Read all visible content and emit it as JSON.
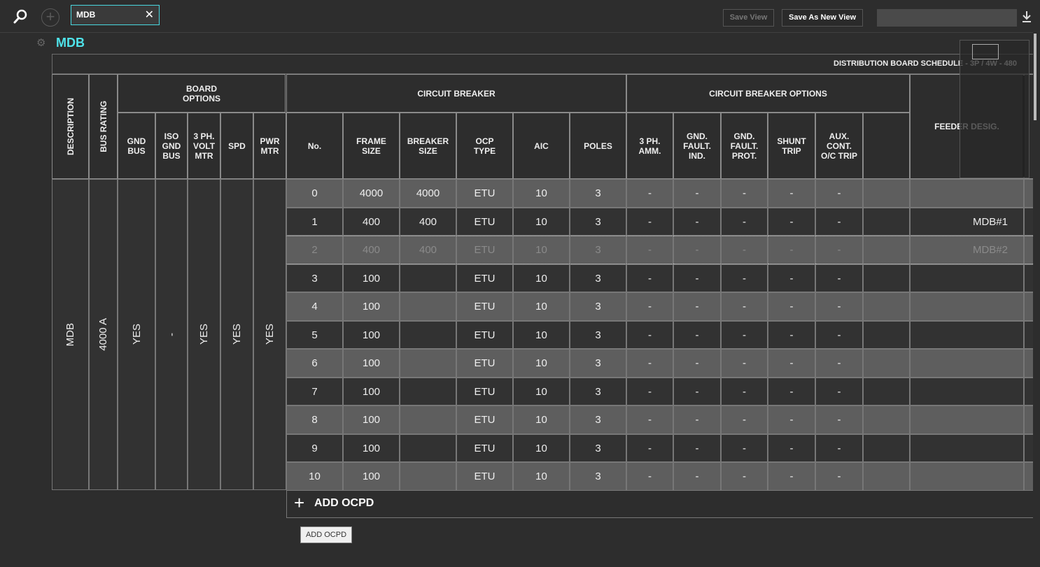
{
  "toolbar": {
    "tab_label": "MDB",
    "tab_close": "✕",
    "add_label": "+",
    "save_view": "Save View",
    "save_as_new_view": "Save As New View",
    "view_name_value": "",
    "download_glyph": "⤓"
  },
  "page": {
    "title": "MDB",
    "schedule_title": "DISTRIBUTION BOARD SCHEDULE - 3P / 4W - 480"
  },
  "headers": {
    "description": "DESCRIPTION",
    "bus_rating": "BUS RATING",
    "board_options": "BOARD OPTIONS",
    "gnd_bus": "GND BUS",
    "iso_gnd_bus": "ISO GND BUS",
    "volt_mtr": "3 PH. VOLT MTR",
    "spd": "SPD",
    "pwr_mtr": "PWR MTR",
    "circuit_breaker": "CIRCUIT BREAKER",
    "no": "No.",
    "frame_size": "FRAME SIZE",
    "breaker_size": "BREAKER SIZE",
    "ocp_type": "OCP TYPE",
    "aic": "AIC",
    "poles": "POLES",
    "cb_options": "CIRCUIT BREAKER OPTIONS",
    "ph_amm": "3 PH. AMM.",
    "gnd_fault_ind": "GND. FAULT. IND.",
    "gnd_fault_prot": "GND. FAULT. PROT.",
    "shunt_trip": "SHUNT TRIP",
    "aux_cont": "AUX. CONT. O/C TRIP",
    "feeder_desig": "FEEDER DESIG."
  },
  "board": {
    "description": "MDB",
    "bus_rating": "4000 A",
    "gnd_bus": "YES",
    "iso_gnd_bus": "-",
    "volt_mtr": "YES",
    "spd": "YES",
    "pwr_mtr": "YES"
  },
  "rows": [
    {
      "no": "0",
      "frame": "4000",
      "breaker": "4000",
      "ocp": "ETU",
      "aic": "10",
      "poles": "3",
      "amm": "-",
      "gfi": "-",
      "gfp": "-",
      "shunt": "-",
      "aux": "-",
      "feeder": ""
    },
    {
      "no": "1",
      "frame": "400",
      "breaker": "400",
      "ocp": "ETU",
      "aic": "10",
      "poles": "3",
      "amm": "-",
      "gfi": "-",
      "gfp": "-",
      "shunt": "-",
      "aux": "-",
      "feeder": "MDB#1"
    },
    {
      "no": "2",
      "frame": "400",
      "breaker": "400",
      "ocp": "ETU",
      "aic": "10",
      "poles": "3",
      "amm": "-",
      "gfi": "-",
      "gfp": "-",
      "shunt": "-",
      "aux": "-",
      "feeder": "MDB#2"
    },
    {
      "no": "3",
      "frame": "100",
      "breaker": "",
      "ocp": "ETU",
      "aic": "10",
      "poles": "3",
      "amm": "-",
      "gfi": "-",
      "gfp": "-",
      "shunt": "-",
      "aux": "-",
      "feeder": ""
    },
    {
      "no": "4",
      "frame": "100",
      "breaker": "",
      "ocp": "ETU",
      "aic": "10",
      "poles": "3",
      "amm": "-",
      "gfi": "-",
      "gfp": "-",
      "shunt": "-",
      "aux": "-",
      "feeder": ""
    },
    {
      "no": "5",
      "frame": "100",
      "breaker": "",
      "ocp": "ETU",
      "aic": "10",
      "poles": "3",
      "amm": "-",
      "gfi": "-",
      "gfp": "-",
      "shunt": "-",
      "aux": "-",
      "feeder": ""
    },
    {
      "no": "6",
      "frame": "100",
      "breaker": "",
      "ocp": "ETU",
      "aic": "10",
      "poles": "3",
      "amm": "-",
      "gfi": "-",
      "gfp": "-",
      "shunt": "-",
      "aux": "-",
      "feeder": ""
    },
    {
      "no": "7",
      "frame": "100",
      "breaker": "",
      "ocp": "ETU",
      "aic": "10",
      "poles": "3",
      "amm": "-",
      "gfi": "-",
      "gfp": "-",
      "shunt": "-",
      "aux": "-",
      "feeder": ""
    },
    {
      "no": "8",
      "frame": "100",
      "breaker": "",
      "ocp": "ETU",
      "aic": "10",
      "poles": "3",
      "amm": "-",
      "gfi": "-",
      "gfp": "-",
      "shunt": "-",
      "aux": "-",
      "feeder": ""
    },
    {
      "no": "9",
      "frame": "100",
      "breaker": "",
      "ocp": "ETU",
      "aic": "10",
      "poles": "3",
      "amm": "-",
      "gfi": "-",
      "gfp": "-",
      "shunt": "-",
      "aux": "-",
      "feeder": ""
    },
    {
      "no": "10",
      "frame": "100",
      "breaker": "",
      "ocp": "ETU",
      "aic": "10",
      "poles": "3",
      "amm": "-",
      "gfi": "-",
      "gfp": "-",
      "shunt": "-",
      "aux": "-",
      "feeder": ""
    }
  ],
  "add_ocpd": {
    "plus": "+",
    "label": "ADD OCPD",
    "tooltip": "ADD OCPD"
  },
  "colors": {
    "accent": "#4fe3ea",
    "row_light": "#5e5e5e",
    "row_dark": "#323232",
    "background": "#2d2d2d"
  },
  "icons": {
    "search": "search-icon",
    "add": "add-circle-icon",
    "close": "close-icon",
    "download": "download-icon",
    "gear": "gear-icon",
    "plus": "plus-icon"
  }
}
